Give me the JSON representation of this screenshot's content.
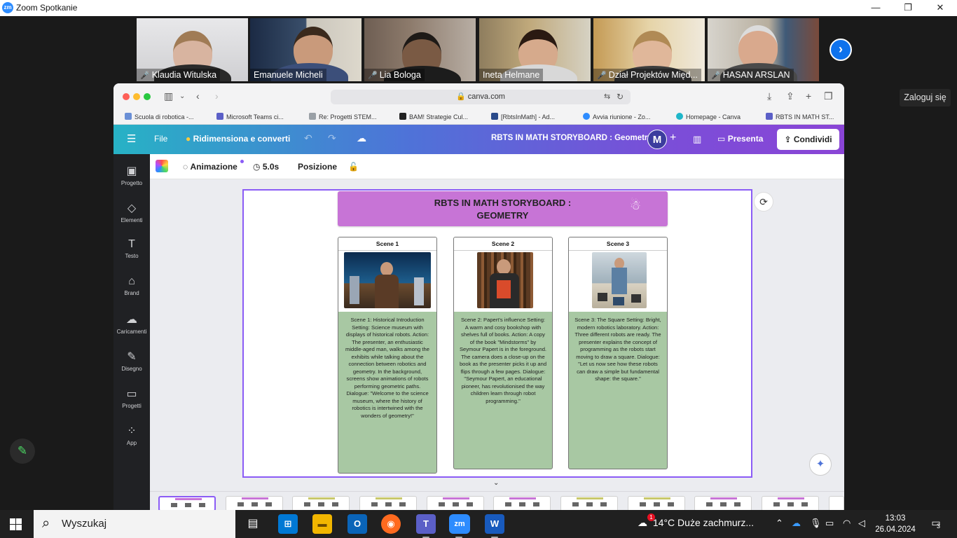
{
  "zoom": {
    "window_title": "Zoom Spotkanie",
    "app_badge": "zm",
    "sign_in": "Zaloguj się",
    "participants": [
      {
        "name": "Klaudia Witulska",
        "muted": true
      },
      {
        "name": "Emanuele Micheli",
        "muted": false
      },
      {
        "name": "Lia Bologa",
        "muted": true
      },
      {
        "name": "Ineta Helmane",
        "muted": false
      },
      {
        "name": "Dział Projektów Międ...",
        "muted": true
      },
      {
        "name": "HASAN ARSLAN",
        "muted": true
      }
    ]
  },
  "browser": {
    "url": "canva.com",
    "bookmarks": [
      "Scuola di robotica -...",
      "Microsoft Teams ci...",
      "Re: Progetti STEM...",
      "BAM! Strategie Cul...",
      "[RbtsInMath] - Ad...",
      "Avvia riunione - Zo...",
      "Homepage - Canva",
      "RBTS IN MATH ST..."
    ]
  },
  "canva": {
    "menu": {
      "file": "File",
      "resize": "Ridimensiona e converti",
      "doc_title": "RBTS IN MATH STORYBOARD : Geometry",
      "avatar": "M",
      "present": "Presenta",
      "share": "Condividi"
    },
    "sidebar": [
      {
        "label": "Progetto"
      },
      {
        "label": "Elementi"
      },
      {
        "label": "Testo"
      },
      {
        "label": "Brand"
      },
      {
        "label": "Caricamenti"
      },
      {
        "label": "Disegno"
      },
      {
        "label": "Progetti"
      },
      {
        "label": "App"
      }
    ],
    "toolbar": {
      "animation": "Animazione",
      "duration": "5.0s",
      "position": "Posizione"
    },
    "slide": {
      "title_line1": "RBTS IN MATH STORYBOARD :",
      "title_line2": "GEOMETRY",
      "scenes": [
        {
          "header": "Scene  1",
          "text": "Scene 1: Historical Introduction Setting: Science museum with displays of historical robots. Action: The presenter, an enthusiastic middle-aged man, walks among the exhibits while talking about the connection between robotics and geometry. In the background, screens show animations of robots performing geometric paths. Dialogue: \"Welcome to the science museum, where the history of robotics is intertwined with the wonders of geometry!\""
        },
        {
          "header": "Scene  2",
          "text": "Scene 2: Papert's influence Setting: A warm and cosy bookshop with shelves full of books. Action: A copy of the book \"Mindstorms\" by Seymour Papert is in the foreground. The camera does a close-up on the book as the presenter picks it up and flips through a few pages. Dialogue: \"Seymour Papert, an educational pioneer, has revolutionised the way children learn through robot programming.\""
        },
        {
          "header": "Scene  3",
          "text": "Scene 3: The Square Setting: Bright, modern robotics laboratory. Action: Three different robots are ready. The presenter explains the concept of programming as the robots start moving to draw a square. Dialogue: \"Let us now see how these robots can draw a simple but fundamental shape: the square.\""
        }
      ]
    }
  },
  "taskbar": {
    "search": "Wyszukaj",
    "weather": "14°C  Duże zachmurz...",
    "weather_badge": "1",
    "time": "13:03",
    "date": "26.04.2024",
    "notifications": "3"
  }
}
